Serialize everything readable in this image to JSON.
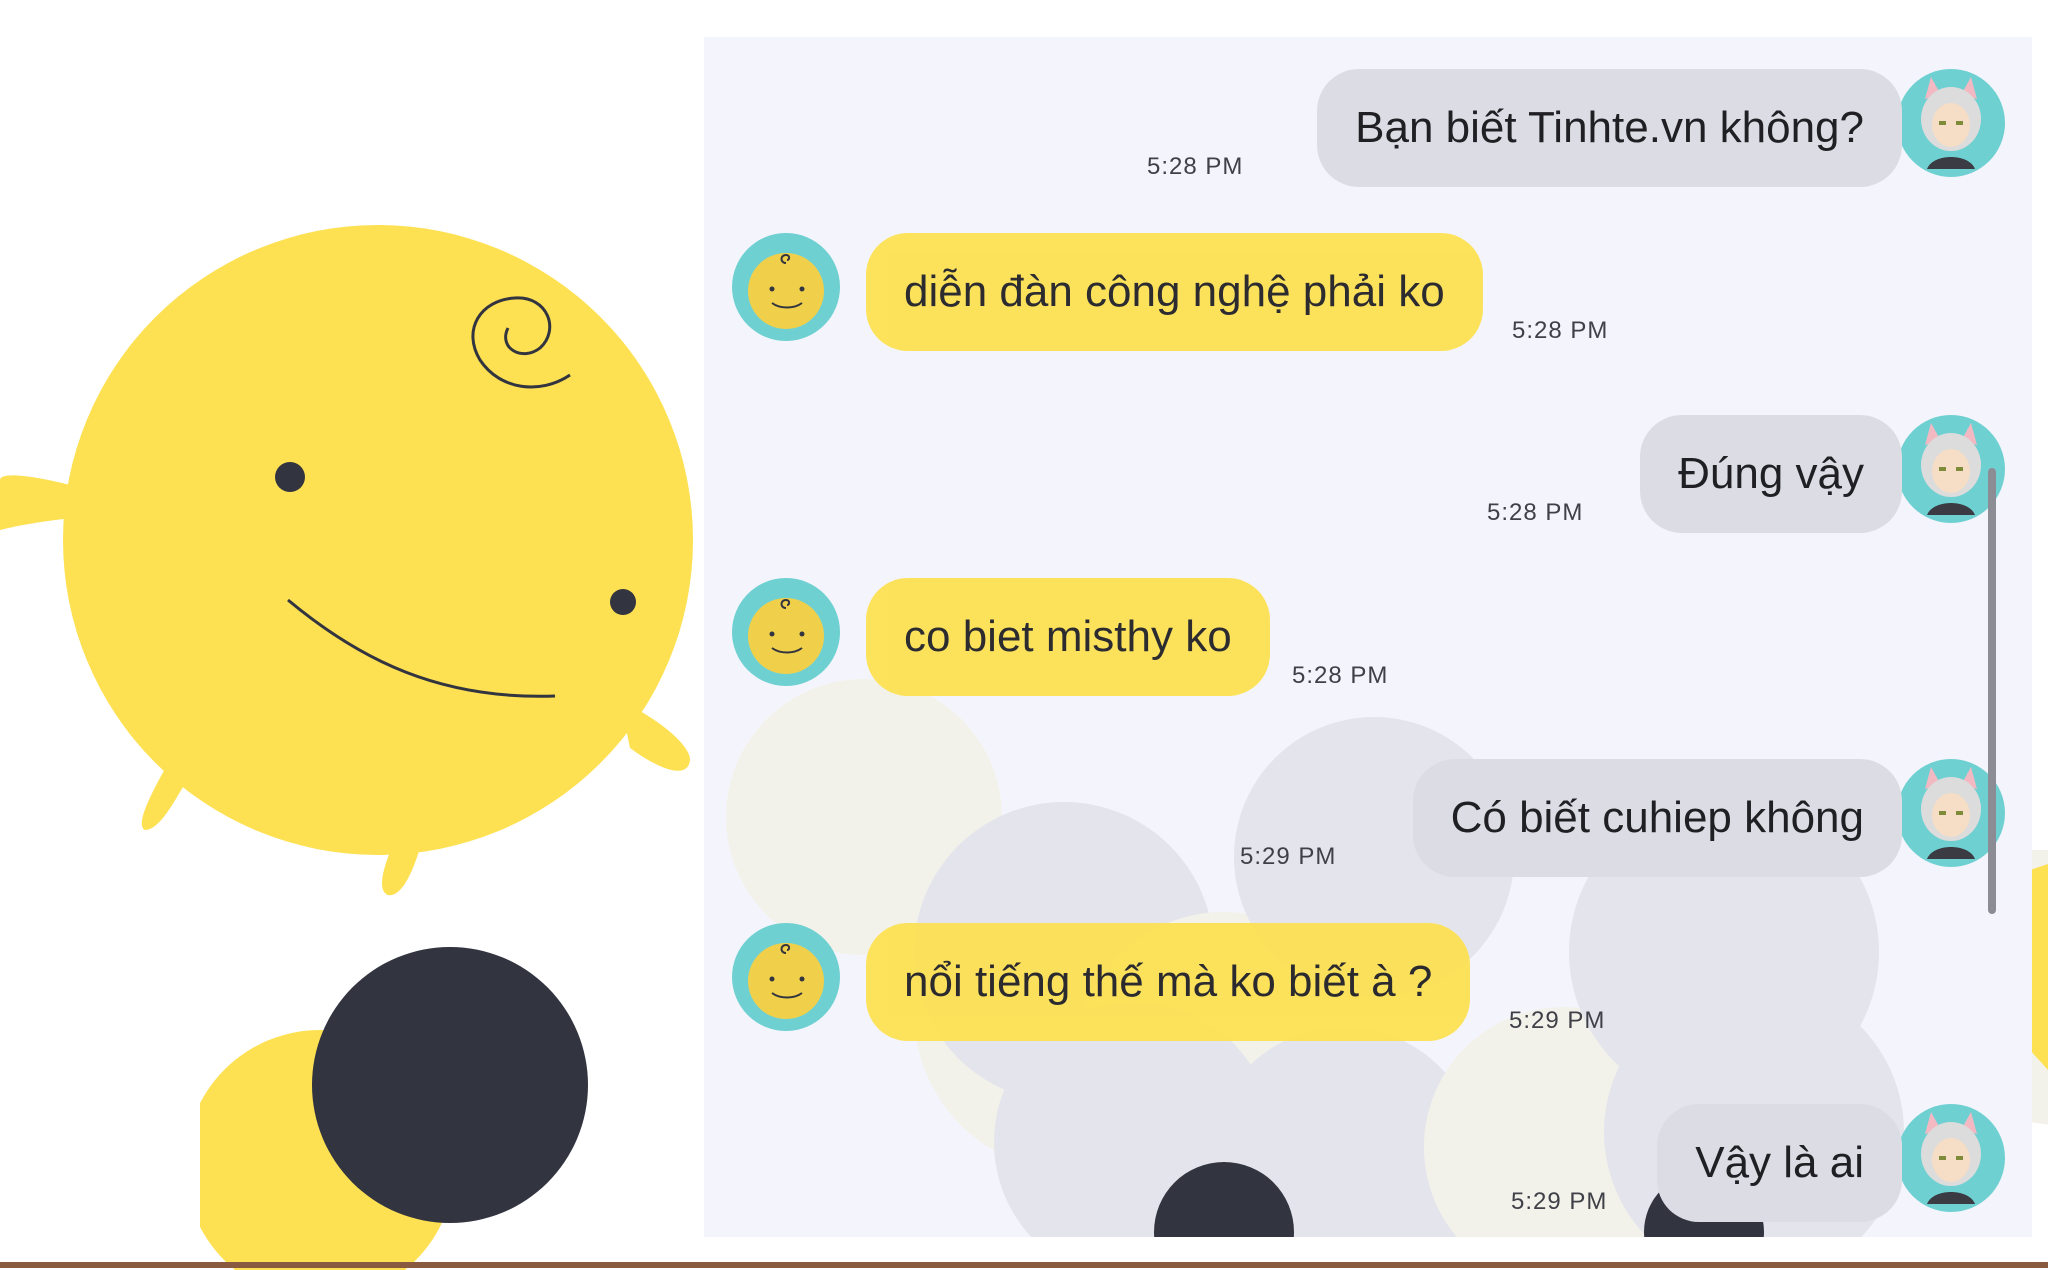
{
  "colors": {
    "accent": "#fde152",
    "user_bubble": "#dcdde4",
    "chat_background": "#f4f5fc",
    "dark": "#323440",
    "avatar_ring": "#6fd0d2"
  },
  "messages": [
    {
      "sender": "user",
      "text": "Bạn biết Tinhte.vn không?",
      "time": "5:28 PM"
    },
    {
      "sender": "bot",
      "text": "diễn đàn công nghệ phải ko",
      "time": "5:28 PM"
    },
    {
      "sender": "user",
      "text": "Đúng vậy",
      "time": "5:28 PM"
    },
    {
      "sender": "bot",
      "text": "co biet misthy ko",
      "time": "5:28 PM"
    },
    {
      "sender": "user",
      "text": "Có biết cuhiep không",
      "time": "5:29 PM"
    },
    {
      "sender": "bot",
      "text": "nổi tiếng thế mà ko biết à ?",
      "time": "5:29 PM"
    },
    {
      "sender": "user",
      "text": "Vậy là ai",
      "time": "5:29 PM"
    }
  ],
  "icons": {
    "bot_avatar": "simsimi-avatar-icon",
    "user_avatar": "user-avatar-icon",
    "mascot": "simsimi-mascot"
  }
}
